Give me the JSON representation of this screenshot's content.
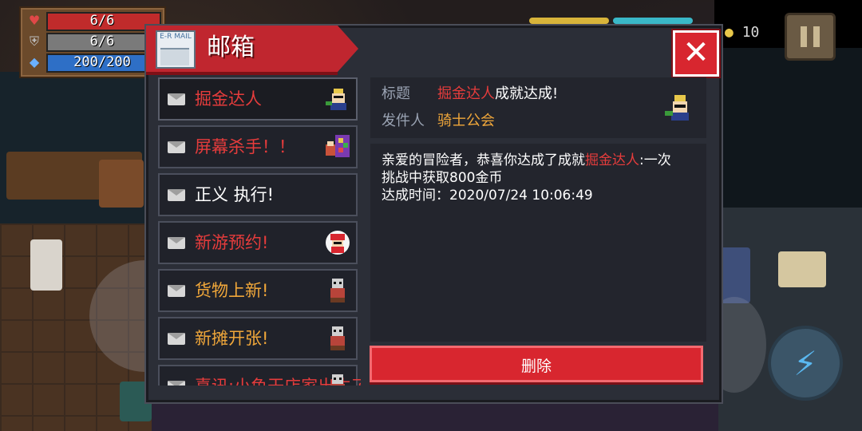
{
  "hud": {
    "hp": "6/6",
    "armor": "6/6",
    "energy": "200/200",
    "gold": "10"
  },
  "dialog": {
    "title": "邮箱",
    "mail_icon_text": "E-R MAIL",
    "close_label": "✕"
  },
  "mails": [
    {
      "label": "掘金达人",
      "color": "#e63c3c",
      "selected": true
    },
    {
      "label": "屏幕杀手！！",
      "color": "#e63c3c",
      "selected": false
    },
    {
      "label": "正义 执行!",
      "color": "#ffffff",
      "selected": false
    },
    {
      "label": "新游预约!",
      "color": "#e63c3c",
      "selected": false
    },
    {
      "label": "货物上新!",
      "color": "#f0a73a",
      "selected": false
    },
    {
      "label": "新摊开张!",
      "color": "#f0a73a",
      "selected": false
    },
    {
      "label": "喜讯:小鱼干店家出生了",
      "color": "#e63c3c",
      "selected": false
    }
  ],
  "detail": {
    "subject_label": "标题",
    "subject_highlight": "掘金达人",
    "subject_rest": "成就达成!",
    "sender_label": "发件人",
    "sender": "骑士公会",
    "body_line1_a": "亲爱的冒险者，恭喜你达成了成就",
    "body_line1_highlight": "掘金达人",
    "body_line1_b": ":一次",
    "body_line2": "挑战中获取800金币",
    "body_line3": "达成时间：2020/07/24 10:06:49",
    "delete_label": "删除"
  },
  "colors": {
    "accent_red": "#d8262f",
    "highlight_red": "#e63c3c",
    "orange": "#f0a73a",
    "panel": "#2b2e37"
  }
}
